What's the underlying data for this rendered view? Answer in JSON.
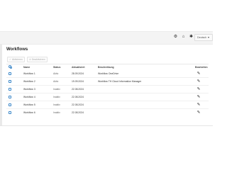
{
  "topbar": {
    "icons": [
      "settings-cog-icon",
      "home-icon",
      "gear-icon"
    ],
    "language_label": "Deutsch"
  },
  "page": {
    "title": "Workflows"
  },
  "actions": [
    {
      "label": "Aktivieren",
      "icon": "check-icon"
    },
    {
      "label": "Deaktivieren",
      "icon": "block-icon"
    }
  ],
  "table": {
    "columns": [
      "Name",
      "Status",
      "Aktualisiert",
      "Beschreibung",
      "Bearbeiten"
    ],
    "rows": [
      {
        "name": "Workflow 1",
        "status": "Aktiv",
        "updated": "28.09.2024",
        "description": "Workflow OneDrive"
      },
      {
        "name": "Workflow 2",
        "status": "Aktiv",
        "updated": "19.09.2024",
        "description": "Workflow TH Cloud Information Manager"
      },
      {
        "name": "Workflow 3",
        "status": "Inaktiv",
        "updated": "22.08.2024",
        "description": ""
      },
      {
        "name": "Workflow 4",
        "status": "Inaktiv",
        "updated": "22.08.2024",
        "description": ""
      },
      {
        "name": "Workflow 5",
        "status": "Inaktiv",
        "updated": "22.08.2024",
        "description": ""
      },
      {
        "name": "Workflow 6",
        "status": "Inaktiv",
        "updated": "22.08.2024",
        "description": ""
      }
    ]
  }
}
